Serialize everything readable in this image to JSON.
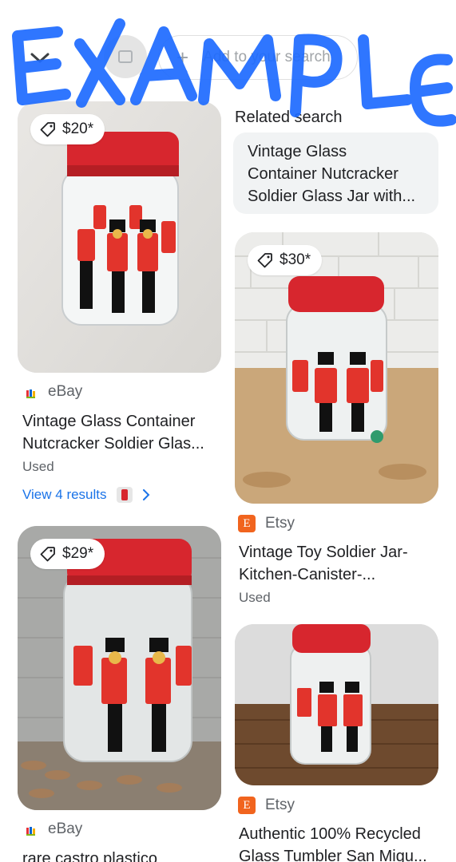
{
  "header": {
    "search_placeholder": "Add to your search"
  },
  "related": {
    "heading": "Related search",
    "text_line1": "Vintage Glass",
    "text_line2": "Container Nutcracker",
    "text_line3": "Soldier Glass Jar with..."
  },
  "results": [
    {
      "price": "$20*",
      "source": "eBay",
      "title_line1": "Vintage Glass Container",
      "title_line2": "Nutcracker Soldier Glas...",
      "condition": "Used",
      "view_results": "View 4 results"
    },
    {
      "price": "$30*",
      "source": "Etsy",
      "title_line1": "Vintage Toy Soldier Jar-",
      "title_line2": "Kitchen-Canister-...",
      "condition": "Used"
    },
    {
      "price": "$29*",
      "source": "eBay",
      "title_line1": "rare castro plastico"
    },
    {
      "source": "Etsy",
      "title_line1": "Authentic 100% Recycled",
      "title_line2": "Glass Tumbler San Migu..."
    }
  ],
  "watermark": "EXAMPLE",
  "icons": {
    "back": "chevron-down-icon",
    "tag": "price-tag-icon",
    "ebay": "ebay-logo-icon",
    "etsy": "etsy-logo-icon",
    "more": "chevron-right-icon"
  },
  "colors": {
    "lid_red": "#d7262e",
    "link_blue": "#1a73e8",
    "etsy_orange": "#f1641e",
    "watermark_blue": "#1e6bff"
  }
}
